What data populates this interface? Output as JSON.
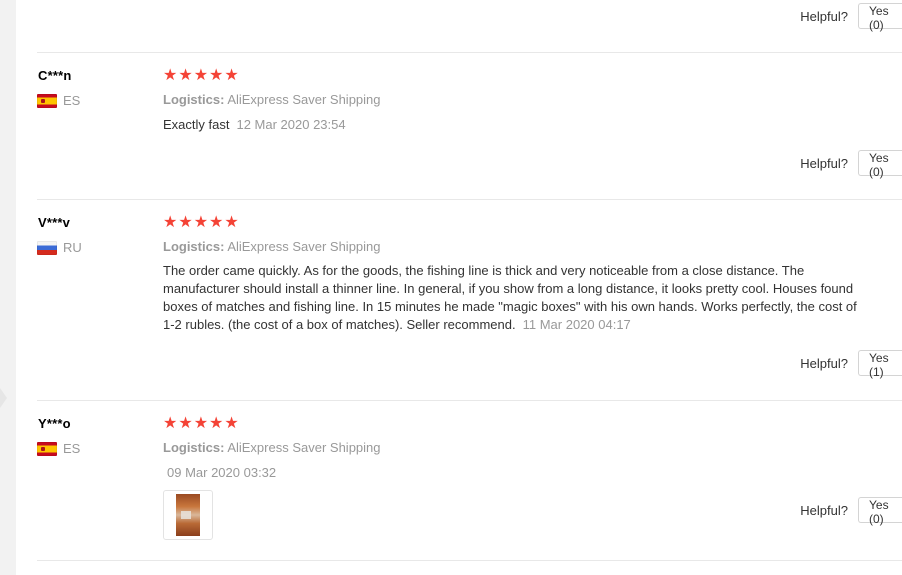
{
  "helpful_label": "Helpful?",
  "logistics_label": "Logistics:",
  "reviews": [
    {
      "helpful_btn": "Yes (0)"
    },
    {
      "user": "C***n",
      "country": "ES",
      "stars": "★★★★★",
      "logistics": "AliExpress Saver Shipping",
      "text": "Exactly fast",
      "date": "12 Mar 2020 23:54",
      "helpful_btn": "Yes (0)"
    },
    {
      "user": "V***v",
      "country": "RU",
      "stars": "★★★★★",
      "logistics": "AliExpress Saver Shipping",
      "text": "The order came quickly. As for the goods, the fishing line is thick and very noticeable from a close distance. The manufacturer should install a thinner line. In general, if you show from a long distance, it looks pretty cool. Houses found boxes of matches and fishing line. In 15 minutes he made \"magic boxes\" with his own hands. Works perfectly, the cost of 1-2 rubles. (the cost of a box of matches). Seller recommend.",
      "date": "11 Mar 2020 04:17",
      "helpful_btn": "Yes (1)"
    },
    {
      "user": "Y***o",
      "country": "ES",
      "stars": "★★★★★",
      "logistics": "AliExpress Saver Shipping",
      "date": "09 Mar 2020 03:32",
      "helpful_btn": "Yes (0)"
    }
  ]
}
